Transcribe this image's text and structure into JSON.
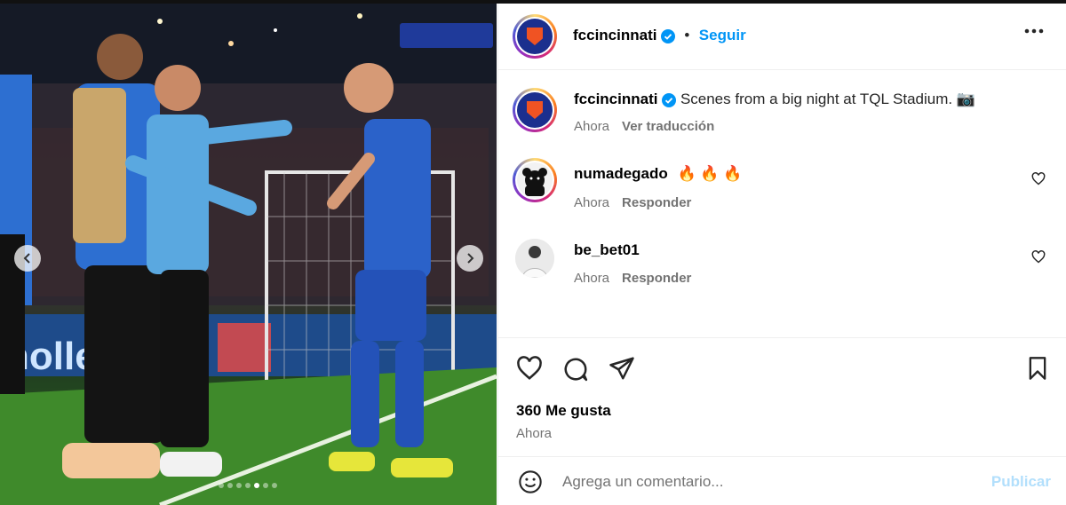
{
  "post": {
    "image_alt": "FC Cincinnati players celebrating a goal at TQL Stadium at night",
    "carousel": {
      "total": 7,
      "active_index": 4
    }
  },
  "header": {
    "username": "fccincinnati",
    "separator": "•",
    "follow_label": "Seguir"
  },
  "caption": {
    "username": "fccincinnati",
    "text": "Scenes from a big night at TQL Stadium. 📷",
    "time": "Ahora",
    "translate_label": "Ver traducción"
  },
  "comments": [
    {
      "username": "numadegado",
      "text": "🔥 🔥 🔥",
      "time": "Ahora",
      "reply_label": "Responder"
    },
    {
      "username": "be_bet01",
      "text": "",
      "time": "Ahora",
      "reply_label": "Responder"
    }
  ],
  "actions": {
    "likes_text": "360 Me gusta",
    "time": "Ahora"
  },
  "comment_box": {
    "placeholder": "Agrega un comentario...",
    "publish_label": "Publicar"
  },
  "colors": {
    "link_blue": "#0095f6",
    "publish_disabled": "#b2dffc",
    "fcc_blue": "#1b2f8e",
    "fcc_orange": "#f05323"
  },
  "icons": [
    "verified-badge-icon",
    "more-options-icon",
    "heart-icon",
    "comment-icon",
    "share-icon",
    "bookmark-icon",
    "emoji-icon",
    "chevron-left-icon",
    "chevron-right-icon",
    "camera-emoji",
    "fire-emoji"
  ]
}
